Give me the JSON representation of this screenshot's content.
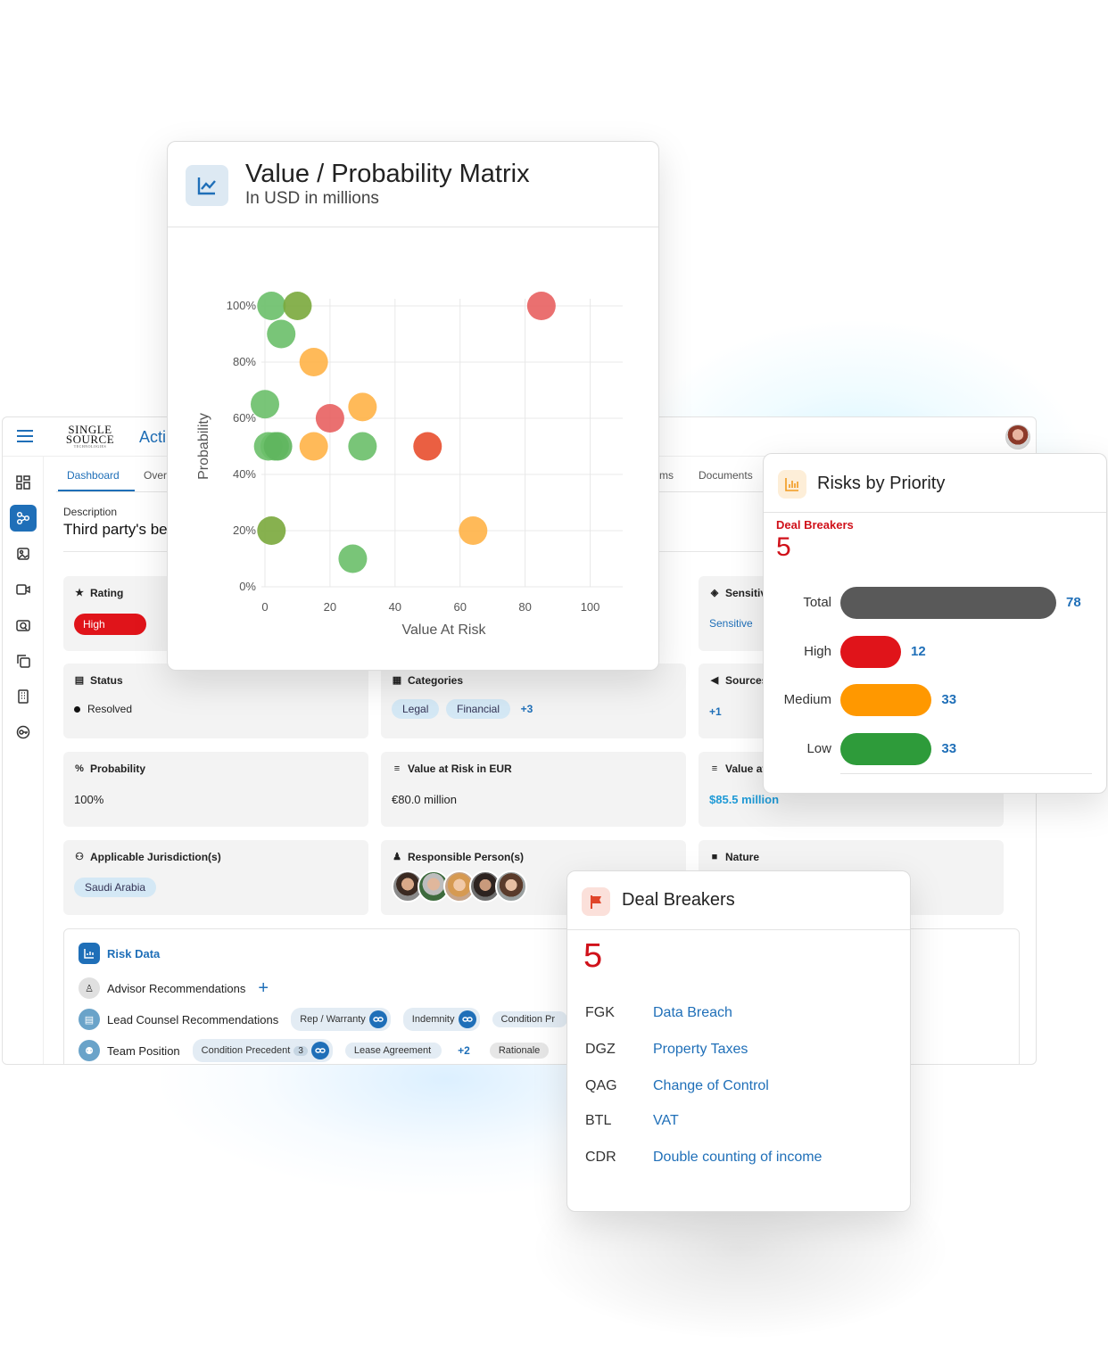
{
  "app": {
    "logo_line1": "SINGLE",
    "logo_line2": "SOURCE",
    "logo_line3": "TECHNOLOGIES",
    "title": "Acti",
    "tabs": [
      "Dashboard",
      "Over",
      "ms",
      "Documents"
    ],
    "description_label": "Description",
    "description_value": "Third party's be",
    "cards": {
      "rating": {
        "label": "Rating",
        "value": "High"
      },
      "sensitivity": {
        "label": "Sensitiv",
        "value": "Sensitive"
      },
      "status": {
        "label": "Status",
        "value": "Resolved"
      },
      "categories": {
        "label": "Categories",
        "tags": [
          "Legal",
          "Financial"
        ],
        "more": "+3"
      },
      "sources": {
        "label": "Sources",
        "more": "+1"
      },
      "probability": {
        "label": "Probability",
        "value": "100%"
      },
      "value_eur": {
        "label": "Value at Risk in EUR",
        "value": "€80.0 million"
      },
      "value_usd": {
        "label": "Value at",
        "value": "$85.5 million"
      },
      "jurisdiction": {
        "label": "Applicable Jurisdiction(s)",
        "value": "Saudi Arabia"
      },
      "responsible": {
        "label": "Responsible Person(s)"
      },
      "nature": {
        "label": "Nature"
      }
    },
    "risk_data": {
      "title": "Risk Data",
      "advisor": "Advisor Recommendations",
      "add": "+",
      "lead_counsel": "Lead Counsel Recommendations",
      "lead_tags": [
        "Rep / Warranty",
        "Indemnity",
        "Condition Pr"
      ],
      "team_position": "Team Position",
      "team_tags": [
        "Condition Precedent",
        "Lease Agreement"
      ],
      "team_tag_count": "3",
      "team_more": "+2",
      "rationale": "Rationale"
    }
  },
  "matrix": {
    "title": "Value / Probability Matrix",
    "subtitle": "In USD in millions"
  },
  "chart_data": {
    "type": "scatter",
    "title": "Value / Probability Matrix",
    "subtitle": "In USD in millions",
    "xlabel": "Value At Risk",
    "ylabel": "Probability",
    "xlim": [
      0,
      110
    ],
    "ylim": [
      0,
      100
    ],
    "x_ticks": [
      0,
      20,
      40,
      60,
      80,
      100
    ],
    "y_ticks": [
      "0%",
      "20%",
      "40%",
      "60%",
      "80%",
      "100%"
    ],
    "grid": true,
    "points": [
      {
        "x": 2,
        "y": 100,
        "color": "#6abf69"
      },
      {
        "x": 10,
        "y": 100,
        "color": "#7aa83c"
      },
      {
        "x": 85,
        "y": 100,
        "color": "#e86060"
      },
      {
        "x": 5,
        "y": 90,
        "color": "#6abf69"
      },
      {
        "x": 15,
        "y": 80,
        "color": "#ffb347"
      },
      {
        "x": 0,
        "y": 65,
        "color": "#6abf69"
      },
      {
        "x": 30,
        "y": 64,
        "color": "#ffb347"
      },
      {
        "x": 20,
        "y": 60,
        "color": "#e86060"
      },
      {
        "x": 1,
        "y": 50,
        "color": "#6abf69"
      },
      {
        "x": 3,
        "y": 50,
        "color": "#6abf69"
      },
      {
        "x": 4,
        "y": 50,
        "color": "#5fb55e"
      },
      {
        "x": 15,
        "y": 50,
        "color": "#ffb347"
      },
      {
        "x": 30,
        "y": 50,
        "color": "#6abf69"
      },
      {
        "x": 50,
        "y": 50,
        "color": "#e84e2e"
      },
      {
        "x": 2,
        "y": 20,
        "color": "#7aa83c"
      },
      {
        "x": 64,
        "y": 20,
        "color": "#ffb347"
      },
      {
        "x": 27,
        "y": 10,
        "color": "#6abf69"
      }
    ]
  },
  "priority": {
    "title": "Risks by Priority",
    "deal_breakers_label": "Deal Breakers",
    "deal_breakers_count": "5",
    "rows": [
      {
        "label": "Total",
        "value": 78,
        "color": "#595959"
      },
      {
        "label": "High",
        "value": 12,
        "color": "#e0141a"
      },
      {
        "label": "Medium",
        "value": 33,
        "color": "#ff9800"
      },
      {
        "label": "Low",
        "value": 33,
        "color": "#2e9b3a"
      }
    ]
  },
  "dealbreakers": {
    "title": "Deal Breakers",
    "count": "5",
    "items": [
      {
        "code": "FGK",
        "name": "Data Breach"
      },
      {
        "code": "DGZ",
        "name": "Property Taxes"
      },
      {
        "code": "QAG",
        "name": "Change of Control"
      },
      {
        "code": "BTL",
        "name": "VAT"
      },
      {
        "code": "CDR",
        "name": "Double counting of income"
      }
    ]
  }
}
